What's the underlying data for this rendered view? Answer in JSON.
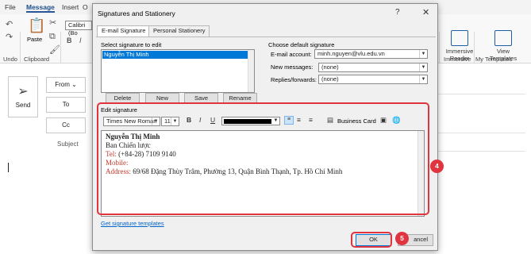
{
  "menu": {
    "file": "File",
    "message": "Message",
    "insert": "Insert",
    "options": "O"
  },
  "ribbon": {
    "undo": "Undo",
    "clipboard": "Clipboard",
    "paste": "Paste",
    "font": "Calibri (Bo",
    "immersive_reader": "Immersive\nReader",
    "immersive": "Immersive",
    "view_templates": "View\nTemplates",
    "my_templates": "My Templates"
  },
  "compose": {
    "send": "Send",
    "from": "From",
    "to": "To",
    "cc": "Cc",
    "subject": "Subject"
  },
  "dialog": {
    "title": "Signatures and Stationery",
    "help": "?",
    "close": "✕",
    "tabs": [
      "E-mail Signature",
      "Personal Stationery"
    ],
    "select_label": "Select signature to edit",
    "signatures": [
      "Nguyễn Thị Minh"
    ],
    "buttons": {
      "delete": "Delete",
      "new": "New",
      "save": "Save",
      "rename": "Rename"
    },
    "default_label": "Choose default signature",
    "email_account_label": "E-mail account:",
    "email_account_value": "minh.nguyen@vlu.edu.vn",
    "new_messages_label": "New messages:",
    "new_messages_value": "(none)",
    "replies_label": "Replies/forwards:",
    "replies_value": "(none)",
    "edit_label": "Edit signature",
    "font_name": "Times New Roman",
    "font_size": "11",
    "bold": "B",
    "italic": "I",
    "underline": "U",
    "business_card": "Business Card",
    "signature_lines": {
      "name": "Nguyễn Thị Minh",
      "dept": "Ban Chiến lược",
      "tel_label": "Tel:",
      "tel_value": " (+84-28) 7109 9140",
      "mobile_label": "Mobile:",
      "address_label": "Address:",
      "address_value": " 69/68 Đặng Thùy Trâm, Phường 13, Quận Bình Thạnh, Tp. Hồ Chí Minh"
    },
    "templates_link": "Get signature templates",
    "ok": "OK",
    "cancel": "ancel"
  },
  "annotations": {
    "step4": "4",
    "step5": "5"
  },
  "colors": {
    "annotation": "#e0343f",
    "selection": "#0078d7",
    "signature_label_red": "#c0392b",
    "accent": "#2b579a"
  }
}
